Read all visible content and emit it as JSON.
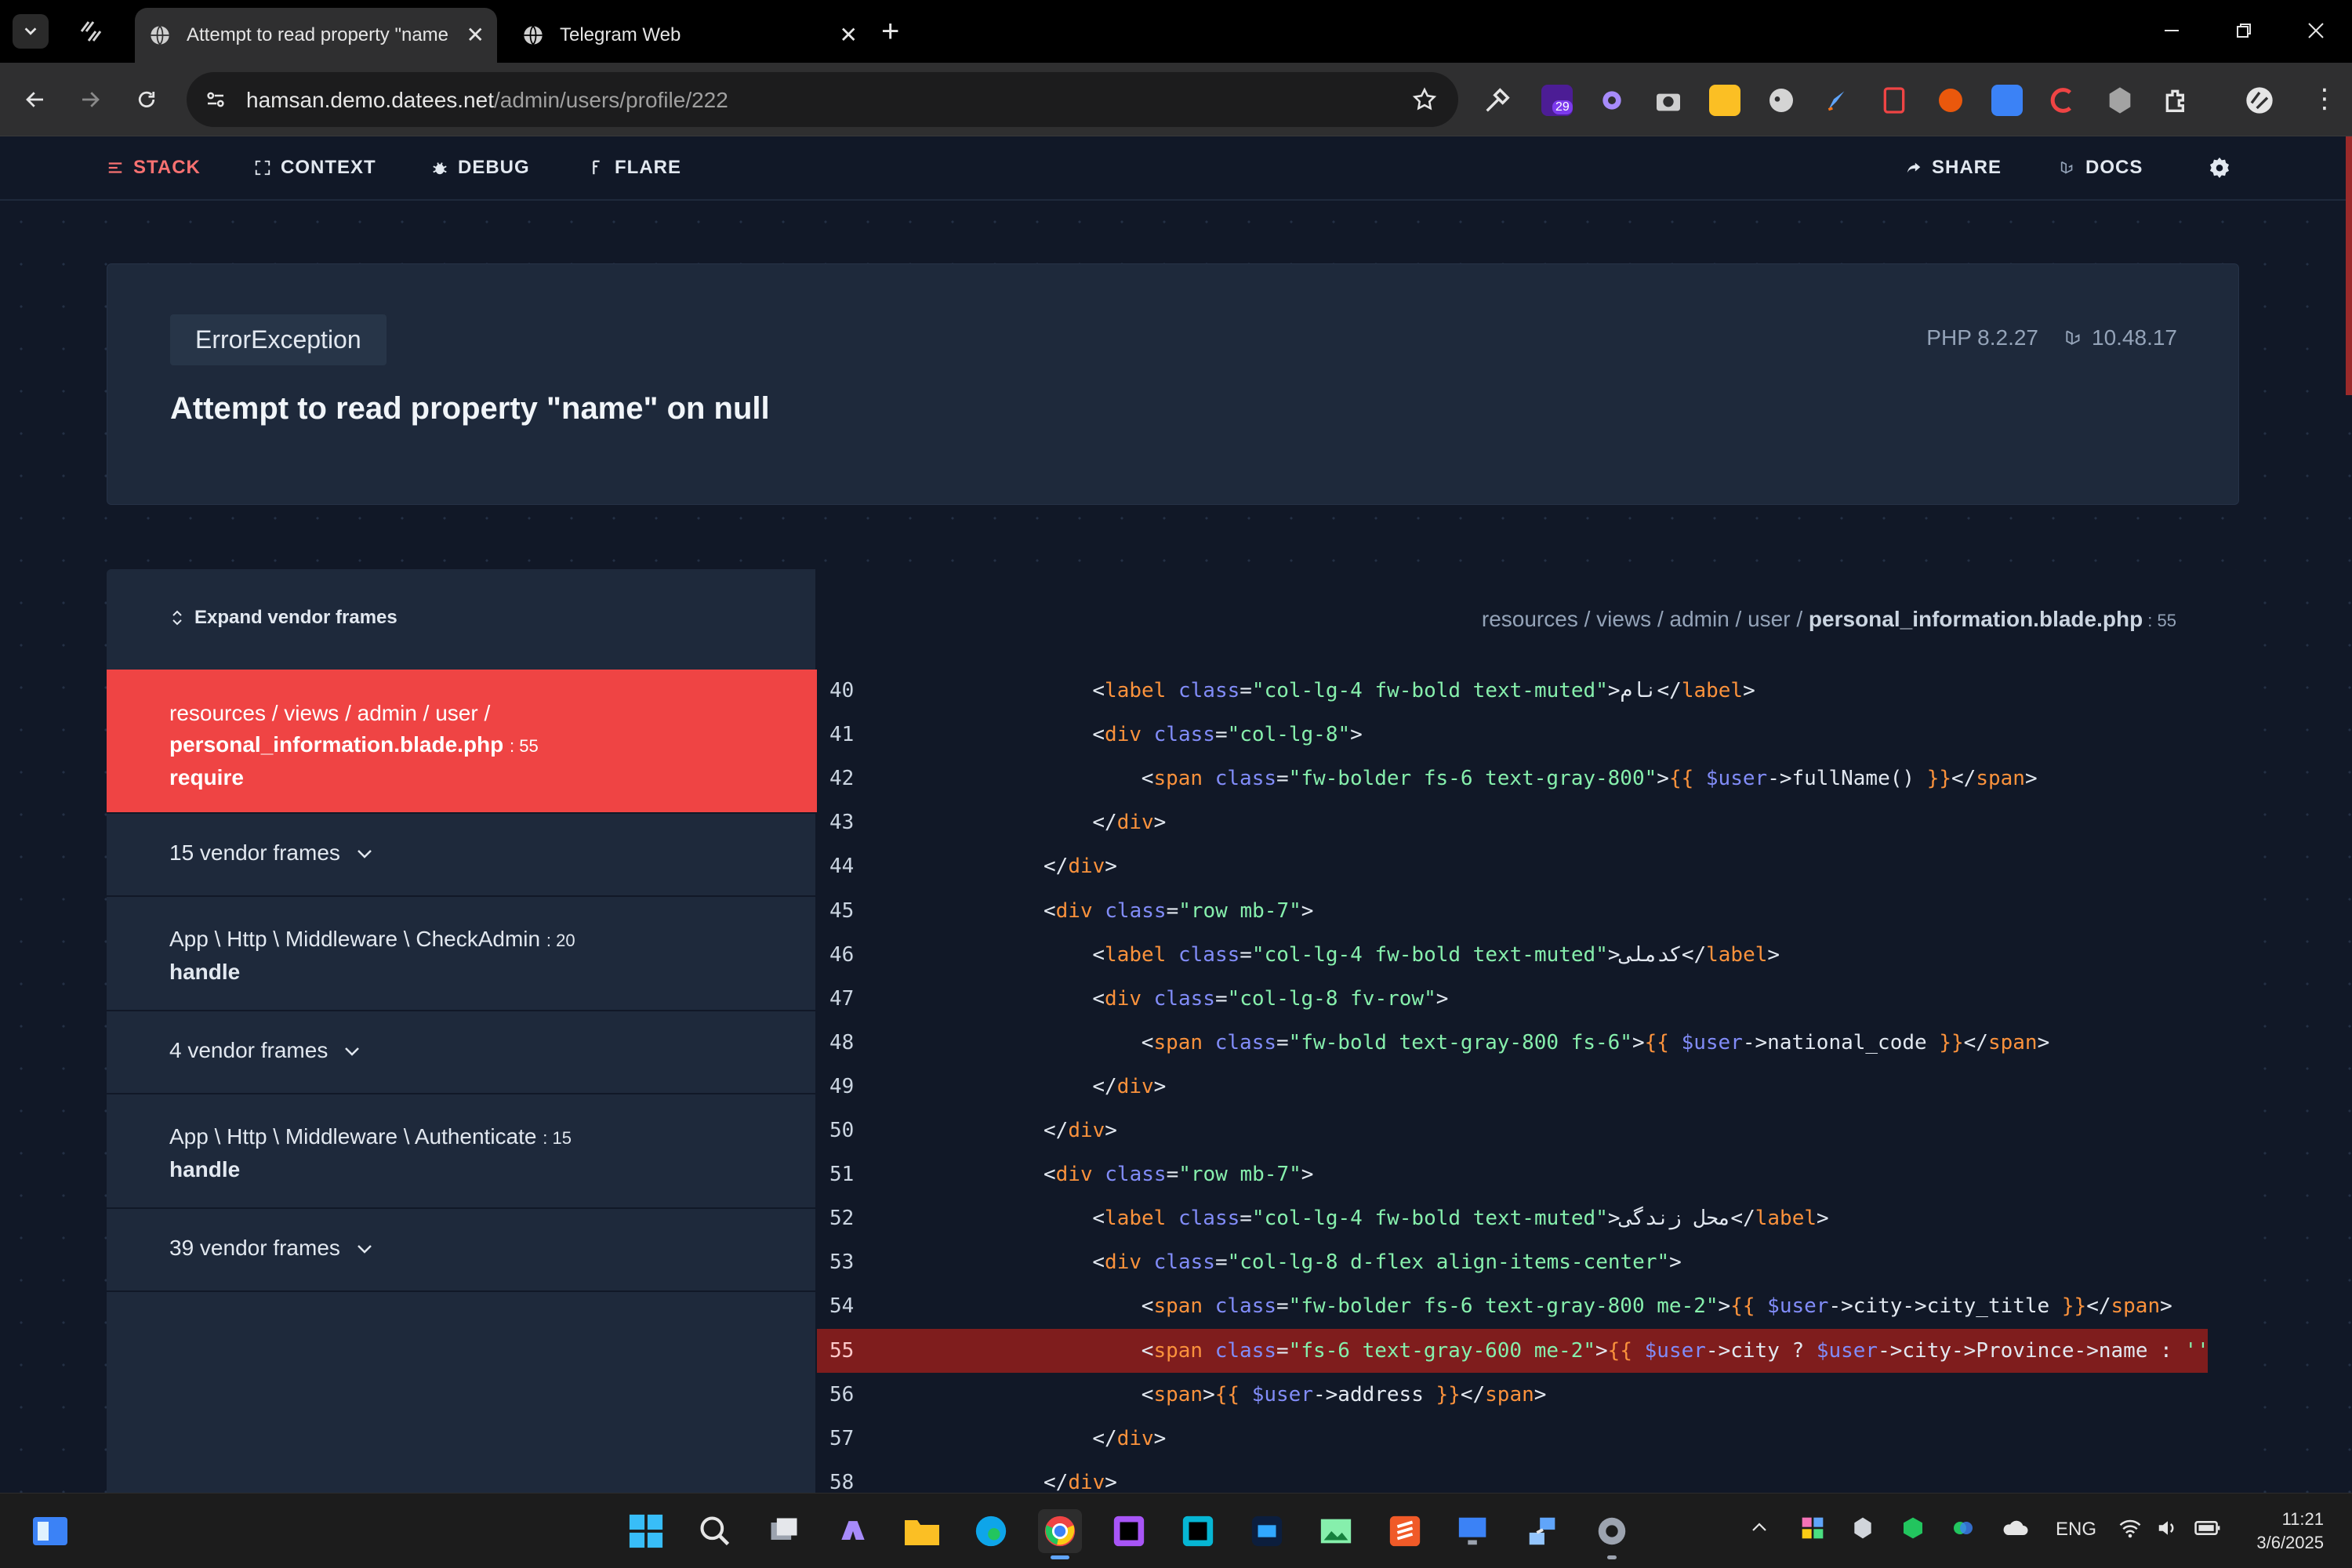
{
  "browser": {
    "tabs": [
      {
        "title": "Attempt to read property \"name",
        "active": true
      },
      {
        "title": "Telegram Web",
        "active": false
      }
    ],
    "url_host": "hamsan.demo.datees.net",
    "url_path": "/admin/users/profile/222",
    "extension_badge": "29"
  },
  "ignition_nav": {
    "stack": "STACK",
    "context": "CONTEXT",
    "debug": "DEBUG",
    "flare": "FLARE",
    "share": "SHARE",
    "docs": "DOCS"
  },
  "exception": {
    "class": "ErrorException",
    "message": "Attempt to read property \"name\" on null",
    "php_version": "PHP 8.2.27",
    "laravel_version": "10.48.17"
  },
  "frames_panel": {
    "expand_label": "Expand vendor frames",
    "selected": {
      "path": "resources / views / admin / user /",
      "file": "personal_information.blade.php",
      "line": ": 55",
      "method": "require"
    },
    "vendor_1": "15 vendor frames",
    "frame_2": {
      "class": "App \\ Http \\ Middleware \\ CheckAdmin",
      "line": ": 20",
      "method": "handle"
    },
    "vendor_2": "4 vendor frames",
    "frame_3": {
      "class": "App \\ Http \\ Middleware \\ Authenticate",
      "line": ": 15",
      "method": "handle"
    },
    "vendor_3": "39 vendor frames"
  },
  "code_panel": {
    "path_prefix": "resources / views / admin / user / ",
    "file": "personal_information.blade.php",
    "line": " : 55",
    "highlighted_line": 55,
    "lines": [
      {
        "n": "40",
        "indent": 8,
        "tokens": [
          [
            "t",
            "<"
          ],
          [
            "tag",
            "label"
          ],
          [
            "t",
            " "
          ],
          [
            "attr",
            "class"
          ],
          [
            "t",
            "="
          ],
          [
            "str",
            "\"col-lg-4 fw-bold text-muted\""
          ],
          [
            "t",
            ">نام</"
          ],
          [
            "tag",
            "label"
          ],
          [
            "t",
            ">"
          ]
        ]
      },
      {
        "n": "41",
        "indent": 8,
        "tokens": [
          [
            "t",
            "<"
          ],
          [
            "tag",
            "div"
          ],
          [
            "t",
            " "
          ],
          [
            "attr",
            "class"
          ],
          [
            "t",
            "="
          ],
          [
            "str",
            "\"col-lg-8\""
          ],
          [
            "t",
            ">"
          ]
        ]
      },
      {
        "n": "42",
        "indent": 12,
        "tokens": [
          [
            "t",
            "<"
          ],
          [
            "tag",
            "span"
          ],
          [
            "t",
            " "
          ],
          [
            "attr",
            "class"
          ],
          [
            "t",
            "="
          ],
          [
            "str",
            "\"fw-bolder fs-6 text-gray-800\""
          ],
          [
            "t",
            ">"
          ],
          [
            "brace",
            "{{"
          ],
          [
            "t",
            " "
          ],
          [
            "var",
            "$user"
          ],
          [
            "t",
            "->fullName() "
          ],
          [
            "brace",
            "}}"
          ],
          [
            "t",
            "</"
          ],
          [
            "tag",
            "span"
          ],
          [
            "t",
            ">"
          ]
        ]
      },
      {
        "n": "43",
        "indent": 8,
        "tokens": [
          [
            "t",
            "</"
          ],
          [
            "tag",
            "div"
          ],
          [
            "t",
            ">"
          ]
        ]
      },
      {
        "n": "44",
        "indent": 4,
        "tokens": [
          [
            "t",
            "</"
          ],
          [
            "tag",
            "div"
          ],
          [
            "t",
            ">"
          ]
        ]
      },
      {
        "n": "45",
        "indent": 4,
        "tokens": [
          [
            "t",
            "<"
          ],
          [
            "tag",
            "div"
          ],
          [
            "t",
            " "
          ],
          [
            "attr",
            "class"
          ],
          [
            "t",
            "="
          ],
          [
            "str",
            "\"row mb-7\""
          ],
          [
            "t",
            ">"
          ]
        ]
      },
      {
        "n": "46",
        "indent": 8,
        "tokens": [
          [
            "t",
            "<"
          ],
          [
            "tag",
            "label"
          ],
          [
            "t",
            " "
          ],
          [
            "attr",
            "class"
          ],
          [
            "t",
            "="
          ],
          [
            "str",
            "\"col-lg-4 fw-bold text-muted\""
          ],
          [
            "t",
            ">کدملی</"
          ],
          [
            "tag",
            "label"
          ],
          [
            "t",
            ">"
          ]
        ]
      },
      {
        "n": "47",
        "indent": 8,
        "tokens": [
          [
            "t",
            "<"
          ],
          [
            "tag",
            "div"
          ],
          [
            "t",
            " "
          ],
          [
            "attr",
            "class"
          ],
          [
            "t",
            "="
          ],
          [
            "str",
            "\"col-lg-8 fv-row\""
          ],
          [
            "t",
            ">"
          ]
        ]
      },
      {
        "n": "48",
        "indent": 12,
        "tokens": [
          [
            "t",
            "<"
          ],
          [
            "tag",
            "span"
          ],
          [
            "t",
            " "
          ],
          [
            "attr",
            "class"
          ],
          [
            "t",
            "="
          ],
          [
            "str",
            "\"fw-bold text-gray-800 fs-6\""
          ],
          [
            "t",
            ">"
          ],
          [
            "brace",
            "{{"
          ],
          [
            "t",
            " "
          ],
          [
            "var",
            "$user"
          ],
          [
            "t",
            "->national_code "
          ],
          [
            "brace",
            "}}"
          ],
          [
            "t",
            "</"
          ],
          [
            "tag",
            "span"
          ],
          [
            "t",
            ">"
          ]
        ]
      },
      {
        "n": "49",
        "indent": 8,
        "tokens": [
          [
            "t",
            "</"
          ],
          [
            "tag",
            "div"
          ],
          [
            "t",
            ">"
          ]
        ]
      },
      {
        "n": "50",
        "indent": 4,
        "tokens": [
          [
            "t",
            "</"
          ],
          [
            "tag",
            "div"
          ],
          [
            "t",
            ">"
          ]
        ]
      },
      {
        "n": "51",
        "indent": 4,
        "tokens": [
          [
            "t",
            "<"
          ],
          [
            "tag",
            "div"
          ],
          [
            "t",
            " "
          ],
          [
            "attr",
            "class"
          ],
          [
            "t",
            "="
          ],
          [
            "str",
            "\"row mb-7\""
          ],
          [
            "t",
            ">"
          ]
        ]
      },
      {
        "n": "52",
        "indent": 8,
        "tokens": [
          [
            "t",
            "<"
          ],
          [
            "tag",
            "label"
          ],
          [
            "t",
            " "
          ],
          [
            "attr",
            "class"
          ],
          [
            "t",
            "="
          ],
          [
            "str",
            "\"col-lg-4 fw-bold text-muted\""
          ],
          [
            "t",
            ">محل زندگی</"
          ],
          [
            "tag",
            "label"
          ],
          [
            "t",
            ">"
          ]
        ]
      },
      {
        "n": "53",
        "indent": 8,
        "tokens": [
          [
            "t",
            "<"
          ],
          [
            "tag",
            "div"
          ],
          [
            "t",
            " "
          ],
          [
            "attr",
            "class"
          ],
          [
            "t",
            "="
          ],
          [
            "str",
            "\"col-lg-8 d-flex align-items-center\""
          ],
          [
            "t",
            ">"
          ]
        ]
      },
      {
        "n": "54",
        "indent": 12,
        "tokens": [
          [
            "t",
            "<"
          ],
          [
            "tag",
            "span"
          ],
          [
            "t",
            " "
          ],
          [
            "attr",
            "class"
          ],
          [
            "t",
            "="
          ],
          [
            "str",
            "\"fw-bolder fs-6 text-gray-800 me-2\""
          ],
          [
            "t",
            ">"
          ],
          [
            "brace",
            "{{"
          ],
          [
            "t",
            " "
          ],
          [
            "var",
            "$user"
          ],
          [
            "t",
            "->city->city_title "
          ],
          [
            "brace",
            "}}"
          ],
          [
            "t",
            "</"
          ],
          [
            "tag",
            "span"
          ],
          [
            "t",
            ">"
          ]
        ]
      },
      {
        "n": "55",
        "indent": 12,
        "tokens": [
          [
            "t",
            "<"
          ],
          [
            "tag",
            "span"
          ],
          [
            "t",
            " "
          ],
          [
            "attr",
            "class"
          ],
          [
            "t",
            "="
          ],
          [
            "str",
            "\"fs-6 text-gray-600 me-2\""
          ],
          [
            "t",
            ">"
          ],
          [
            "brace",
            "{{"
          ],
          [
            "t",
            " "
          ],
          [
            "var",
            "$user"
          ],
          [
            "t",
            "->city ? "
          ],
          [
            "var",
            "$user"
          ],
          [
            "t",
            "->city->Province->name : "
          ],
          [
            "str",
            "''"
          ]
        ]
      },
      {
        "n": "56",
        "indent": 12,
        "tokens": [
          [
            "t",
            "<"
          ],
          [
            "tag",
            "span"
          ],
          [
            "t",
            ">"
          ],
          [
            "brace",
            "{{"
          ],
          [
            "t",
            " "
          ],
          [
            "var",
            "$user"
          ],
          [
            "t",
            "->address "
          ],
          [
            "brace",
            "}}"
          ],
          [
            "t",
            "</"
          ],
          [
            "tag",
            "span"
          ],
          [
            "t",
            ">"
          ]
        ]
      },
      {
        "n": "57",
        "indent": 8,
        "tokens": [
          [
            "t",
            "</"
          ],
          [
            "tag",
            "div"
          ],
          [
            "t",
            ">"
          ]
        ]
      },
      {
        "n": "58",
        "indent": 4,
        "tokens": [
          [
            "t",
            "</"
          ],
          [
            "tag",
            "div"
          ],
          [
            "t",
            ">"
          ]
        ]
      }
    ]
  },
  "taskbar": {
    "lang": "ENG",
    "time": "11:21",
    "date": "3/6/2025"
  },
  "colors": {
    "accent_red": "#ef4444",
    "highlight_line": "#7f1d1d",
    "panel": "#1e293b",
    "background": "#111827"
  }
}
